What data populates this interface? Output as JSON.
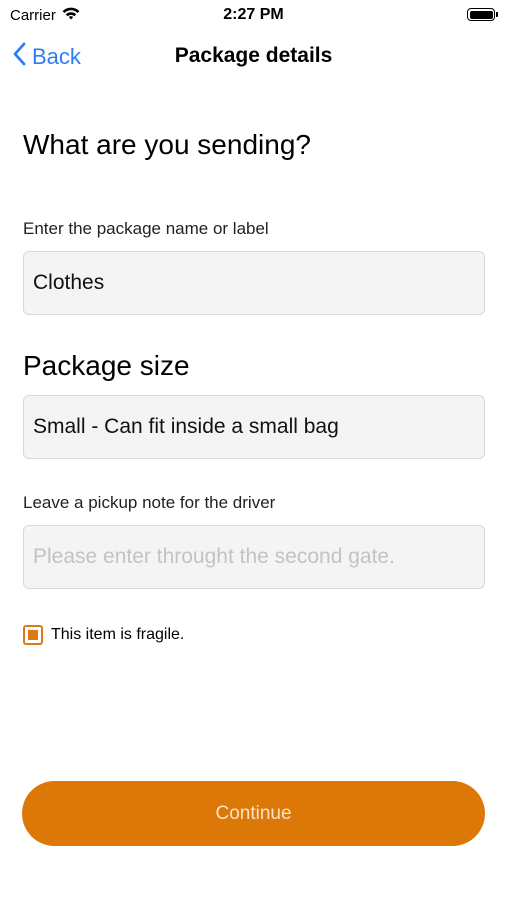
{
  "status_bar": {
    "carrier": "Carrier",
    "time": "2:27 PM"
  },
  "nav": {
    "back_label": "Back",
    "title": "Package details"
  },
  "form": {
    "heading": "What are you sending?",
    "name_label": "Enter the package name or label",
    "name_value": "Clothes",
    "size_heading": "Package size",
    "size_value": "Small - Can fit inside a small bag",
    "note_label": "Leave a pickup note for the driver",
    "note_placeholder": "Please enter throught the second gate.",
    "fragile_label": "This item is fragile.",
    "fragile_checked": true
  },
  "actions": {
    "continue_label": "Continue"
  },
  "colors": {
    "accent": "#dc7808",
    "link": "#2f7df6",
    "field_bg": "#f4f4f4"
  }
}
